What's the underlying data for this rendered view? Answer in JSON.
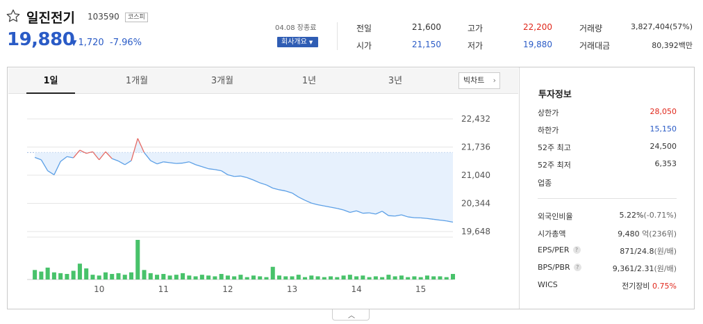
{
  "stock": {
    "name": "일진전기",
    "code": "103590",
    "market": "코스피",
    "price": "19,880",
    "change": "1,720",
    "change_pct": "-7.96%",
    "date_status": "04.08 장종료",
    "company_button": "회사개요"
  },
  "stats": {
    "prev_close_label": "전일",
    "prev_close": "21,600",
    "open_label": "시가",
    "open": "21,150",
    "high_label": "고가",
    "high": "22,200",
    "low_label": "저가",
    "low": "19,880",
    "volume_label": "거래량",
    "volume": "3,827,404(57%)",
    "amount_label": "거래대금",
    "amount": "80,392백만"
  },
  "tabs": [
    "1일",
    "1개월",
    "3개월",
    "1년",
    "3년"
  ],
  "active_tab": "1일",
  "bigchart_label": "빅차트",
  "investment": {
    "title": "투자정보",
    "upper_limit_label": "상한가",
    "upper_limit": "28,050",
    "lower_limit_label": "하한가",
    "lower_limit": "15,150",
    "w52_high_label": "52주 최고",
    "w52_high": "24,500",
    "w52_low_label": "52주 최저",
    "w52_low": "6,353",
    "sector_label": "업종",
    "foreign_ratio_label": "외국인비율",
    "foreign_ratio": "5.22%",
    "foreign_ratio_change": "(-0.71%)",
    "market_cap_label": "시가총액",
    "market_cap": "9,480",
    "market_cap_unit": "억(236위)",
    "eps_per_label": "EPS/PER",
    "eps_per": "871/24.8",
    "eps_per_unit": "(원/배)",
    "bps_pbr_label": "BPS/PBR",
    "bps_pbr": "9,361/2.31",
    "bps_pbr_unit": "(원/배)",
    "wics_label": "WICS",
    "wics": "전기장비",
    "wics_change": "0.75%"
  },
  "colors": {
    "up": "#e0271b",
    "down": "#2a5bc6",
    "area": "#e7f1fd",
    "line": "#5b9fe6",
    "volume": "#48c26a"
  },
  "chart_data": {
    "type": "area",
    "y_ticks": [
      "22,432",
      "21,736",
      "21,040",
      "20,344",
      "19,648"
    ],
    "x_ticks": [
      "10",
      "11",
      "12",
      "13",
      "14",
      "15"
    ],
    "ylim": [
      19648,
      22432
    ],
    "prev_close": 21600,
    "x_hours": [
      9.0,
      9.1,
      9.2,
      9.3,
      9.4,
      9.5,
      9.6,
      9.7,
      9.8,
      9.9,
      10.0,
      10.1,
      10.2,
      10.3,
      10.4,
      10.5,
      10.6,
      10.7,
      10.8,
      10.9,
      11.0,
      11.1,
      11.2,
      11.3,
      11.4,
      11.5,
      11.6,
      11.7,
      11.8,
      11.9,
      12.0,
      12.1,
      12.2,
      12.3,
      12.4,
      12.5,
      12.6,
      12.7,
      12.8,
      12.9,
      13.0,
      13.1,
      13.2,
      13.3,
      13.4,
      13.5,
      13.6,
      13.7,
      13.8,
      13.9,
      14.0,
      14.1,
      14.2,
      14.3,
      14.4,
      14.5,
      14.6,
      14.7,
      14.8,
      14.9,
      15.0,
      15.1,
      15.2,
      15.3,
      15.4,
      15.5
    ],
    "price": [
      21480,
      21420,
      21150,
      21050,
      21380,
      21500,
      21470,
      21660,
      21580,
      21620,
      21420,
      21620,
      21450,
      21390,
      21300,
      21400,
      21950,
      21600,
      21400,
      21320,
      21370,
      21350,
      21330,
      21340,
      21370,
      21300,
      21250,
      21200,
      21180,
      21150,
      21050,
      21010,
      21020,
      20980,
      20920,
      20850,
      20800,
      20720,
      20680,
      20650,
      20600,
      20500,
      20420,
      20350,
      20310,
      20280,
      20250,
      20220,
      20180,
      20120,
      20160,
      20100,
      20110,
      20080,
      20150,
      20040,
      20030,
      20060,
      20010,
      19990,
      19985,
      19970,
      19950,
      19930,
      19910,
      19880
    ],
    "volume": [
      12,
      10,
      15,
      9,
      8,
      7,
      11,
      20,
      14,
      6,
      5,
      9,
      7,
      8,
      6,
      9,
      50,
      12,
      8,
      6,
      7,
      5,
      6,
      8,
      5,
      4,
      6,
      5,
      4,
      7,
      5,
      4,
      6,
      3,
      5,
      4,
      3,
      16,
      5,
      4,
      4,
      6,
      3,
      5,
      4,
      3,
      4,
      3,
      5,
      6,
      4,
      5,
      3,
      4,
      3,
      6,
      4,
      5,
      3,
      4,
      3,
      5,
      4,
      4,
      3,
      7
    ]
  }
}
